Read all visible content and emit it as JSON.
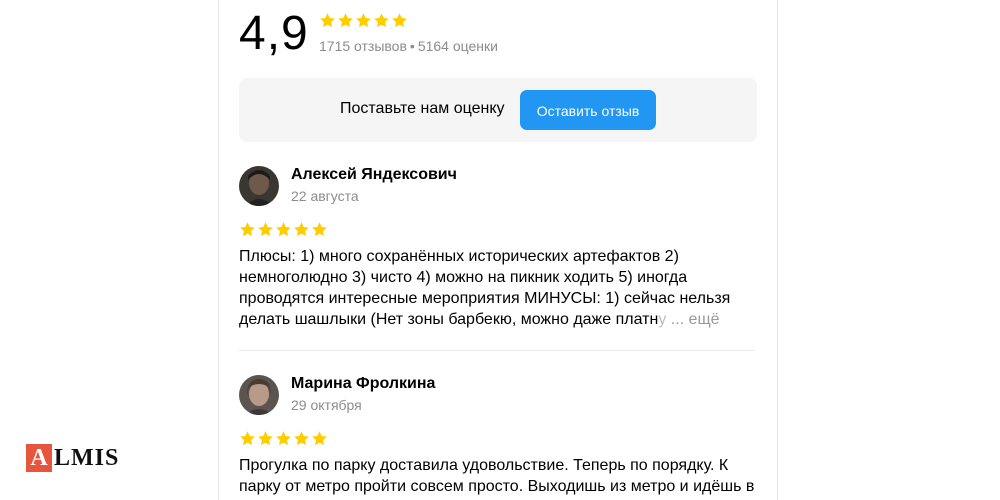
{
  "summary": {
    "score": "4,9",
    "star_count": 5,
    "reviews_count": "1715 отзывов",
    "separator": "•",
    "ratings_count": "5164 оценки"
  },
  "rate_prompt": {
    "text": "Поставьте нам оценку",
    "button_label": "Оставить отзыв"
  },
  "reviews": [
    {
      "author": "Алексей Яндексович",
      "date": "22 августа",
      "rating": 5,
      "text_lines": [
        "Плюсы: 1) много сохранённых исторических артефактов 2)",
        "немноголюдно 3) чисто 4) можно на пикник ходить 5) иногда",
        "проводятся интересные мероприятия МИНУСЫ: 1) сейчас нельзя"
      ],
      "last_line": "делать шашлыки (Нет зоны барбекю, можно даже платн",
      "last_line_faded": "у",
      "more_label": "... ещё"
    },
    {
      "author": "Марина Фролкина",
      "date": "29 октября",
      "rating": 5,
      "text_lines": [
        "Прогулка по парку доставила удовольствие. Теперь по порядку. К",
        "парку от метро пройти совсем просто. Выходишь из метро и идёшь в"
      ]
    }
  ],
  "logo": {
    "first_letter": "A",
    "rest": "LMIS"
  },
  "colors": {
    "star": "#fc0",
    "button": "#2196f3",
    "logo_accent": "#e8553e"
  },
  "icons": {
    "star": "star-icon",
    "avatar": "user-avatar"
  }
}
